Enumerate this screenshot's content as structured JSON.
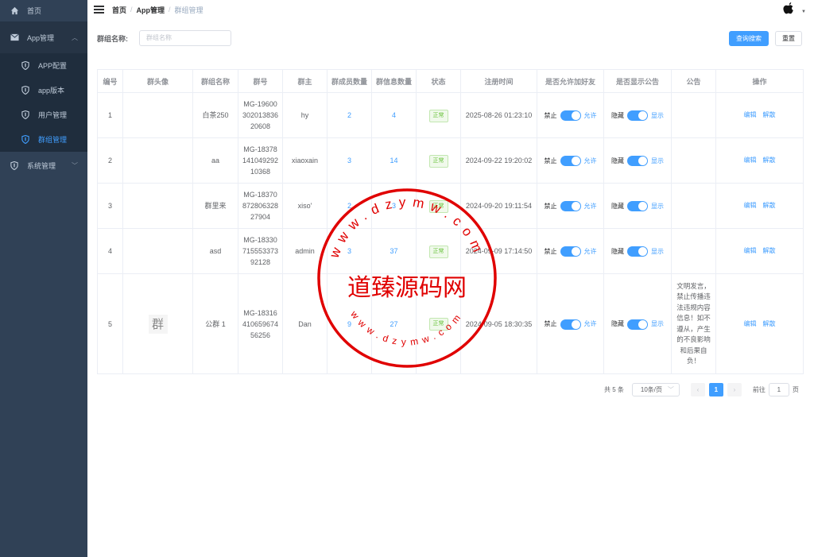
{
  "sidebar": {
    "home": "首页",
    "app_manage": "App管理",
    "sub_items": [
      "APP配置",
      "app版本",
      "用户管理",
      "群组管理"
    ],
    "system": "系统管理"
  },
  "breadcrumb": {
    "home": "首页",
    "parent": "App管理",
    "current": "群组管理"
  },
  "filter": {
    "label": "群组名称:",
    "placeholder": "群组名称",
    "search": "查询搜索",
    "reset": "重置"
  },
  "table": {
    "headers": [
      "编号",
      "群头像",
      "群组名称",
      "群号",
      "群主",
      "群成员数量",
      "群信息数量",
      "状态",
      "注册时间",
      "是否允许加好友",
      "是否显示公告",
      "公告",
      "操作"
    ],
    "rows": [
      {
        "id": "1",
        "name": "白茶250",
        "no": "MG-19600 302013836 20608",
        "owner": "hy",
        "members": "2",
        "msgs": "4",
        "status": "正常",
        "time": "2025-08-26 01:23:10",
        "notice": ""
      },
      {
        "id": "2",
        "name": "aa",
        "no": "MG-18378 141049292 10368",
        "owner": "xiaoxain",
        "members": "3",
        "msgs": "14",
        "status": "正常",
        "time": "2024-09-22 19:20:02",
        "notice": ""
      },
      {
        "id": "3",
        "name": "群里来",
        "no": "MG-18370 872806328 27904",
        "owner": "xiso'",
        "members": "2",
        "msgs": "3",
        "status": "正常",
        "time": "2024-09-20 19:11:54",
        "notice": ""
      },
      {
        "id": "4",
        "name": "asd",
        "no": "MG-18330 715553373 92128",
        "owner": "admin",
        "members": "3",
        "msgs": "37",
        "status": "正常",
        "time": "2024-09-09 17:14:50",
        "notice": ""
      },
      {
        "id": "5",
        "name": "公群 1",
        "no": "MG-18316 410659674 56256",
        "owner": "Dan",
        "members": "9",
        "msgs": "27",
        "status": "正常",
        "time": "2024-09-05 18:30:35",
        "notice": "文明发言，禁止传播违法违规内容信息！如不遵从，产生的不良影响和后果自负！",
        "avatar_char": "群"
      }
    ],
    "friend_off": "禁止",
    "friend_on": "允许",
    "notice_off": "隐藏",
    "notice_on": "显示",
    "edit": "编辑",
    "dissolve": "解散"
  },
  "pager": {
    "total": "共 5 条",
    "size": "10条/页",
    "page": "1",
    "goto": "前往",
    "goto_val": "1",
    "page_suffix": "页"
  },
  "watermark": {
    "text": "道臻源码网",
    "url": "www.dzymw.com"
  }
}
